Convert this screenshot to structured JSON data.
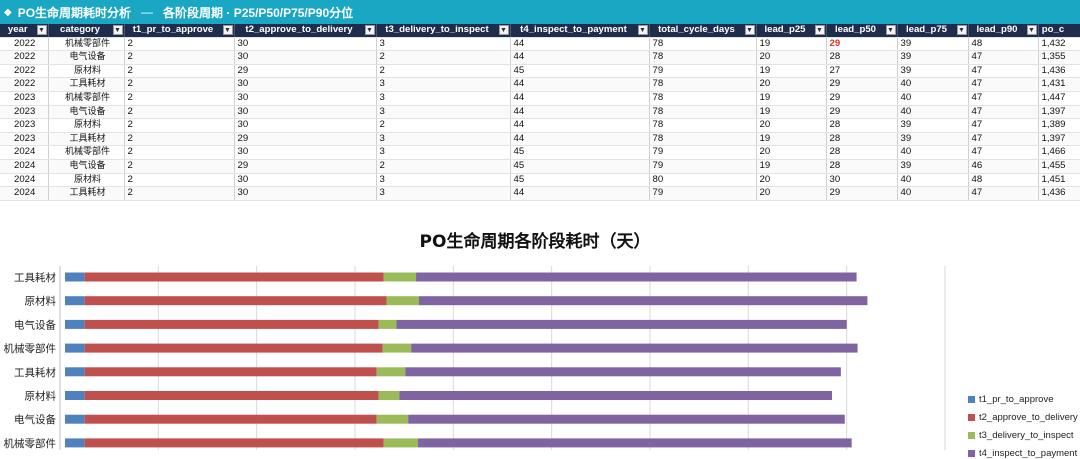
{
  "header": {
    "title": "PO生命周期耗时分析",
    "dash": "—",
    "subtitle": "各阶段周期 · P25/P50/P75/P90分位"
  },
  "table": {
    "columns": [
      "year",
      "category",
      "t1_pr_to_approve",
      "t2_approve_to_delivery",
      "t3_delivery_to_inspect",
      "t4_inspect_to_payment",
      "total_cycle_days",
      "lead_p25",
      "lead_p50",
      "lead_p75",
      "lead_p90",
      "po_c"
    ],
    "rows": [
      [
        "2022",
        "机械零部件",
        "2",
        "30",
        "3",
        "44",
        "78",
        "19",
        "29",
        "39",
        "48",
        "1,432"
      ],
      [
        "2022",
        "电气设备",
        "2",
        "30",
        "2",
        "44",
        "78",
        "20",
        "28",
        "39",
        "47",
        "1,355"
      ],
      [
        "2022",
        "原材料",
        "2",
        "29",
        "2",
        "45",
        "79",
        "19",
        "27",
        "39",
        "47",
        "1,436"
      ],
      [
        "2022",
        "工具耗材",
        "2",
        "30",
        "3",
        "44",
        "78",
        "20",
        "29",
        "40",
        "47",
        "1,431"
      ],
      [
        "2023",
        "机械零部件",
        "2",
        "30",
        "3",
        "44",
        "78",
        "19",
        "29",
        "40",
        "47",
        "1,447"
      ],
      [
        "2023",
        "电气设备",
        "2",
        "30",
        "3",
        "44",
        "78",
        "19",
        "29",
        "40",
        "47",
        "1,397"
      ],
      [
        "2023",
        "原材料",
        "2",
        "30",
        "2",
        "44",
        "78",
        "20",
        "28",
        "39",
        "47",
        "1,389"
      ],
      [
        "2023",
        "工具耗材",
        "2",
        "29",
        "3",
        "44",
        "78",
        "19",
        "28",
        "39",
        "47",
        "1,397"
      ],
      [
        "2024",
        "机械零部件",
        "2",
        "30",
        "3",
        "45",
        "79",
        "20",
        "28",
        "40",
        "47",
        "1,466"
      ],
      [
        "2024",
        "电气设备",
        "2",
        "29",
        "2",
        "45",
        "79",
        "19",
        "28",
        "39",
        "46",
        "1,455"
      ],
      [
        "2024",
        "原材料",
        "2",
        "30",
        "3",
        "45",
        "80",
        "20",
        "30",
        "40",
        "48",
        "1,451"
      ],
      [
        "2024",
        "工具耗材",
        "2",
        "30",
        "3",
        "44",
        "79",
        "20",
        "29",
        "40",
        "47",
        "1,436"
      ]
    ],
    "highlight": {
      "row": 0,
      "col": 8,
      "color": "#e0302a"
    }
  },
  "chart_data": {
    "type": "bar",
    "orientation": "horizontal",
    "stacked": true,
    "title": "PO生命周期各阶段耗时（天）",
    "categories": [
      "工具耗材",
      "原材料",
      "电气设备",
      "机械零部件",
      "工具耗材",
      "原材料",
      "电气设备",
      "机械零部件"
    ],
    "series": [
      {
        "name": "t1_pr_to_approve",
        "color": "#4f81bd",
        "values": [
          2,
          2,
          2,
          2,
          2,
          2,
          2,
          2
        ]
      },
      {
        "name": "t2_approve_to_delivery",
        "color": "#c0504d",
        "values": [
          30.4,
          30.7,
          29.9,
          30.3,
          29.7,
          29.9,
          29.7,
          30.4
        ]
      },
      {
        "name": "t3_delivery_to_inspect",
        "color": "#9bbb59",
        "values": [
          3.3,
          3.3,
          1.8,
          2.9,
          2.9,
          2.1,
          3.2,
          3.5
        ]
      },
      {
        "name": "t4_inspect_to_payment",
        "color": "#8064a2",
        "values": [
          44.8,
          45.6,
          45.8,
          45.4,
          44.3,
          44.0,
          44.4,
          44.1
        ]
      }
    ],
    "xlim": [
      0,
      90
    ],
    "grid": true,
    "legend": "right"
  }
}
